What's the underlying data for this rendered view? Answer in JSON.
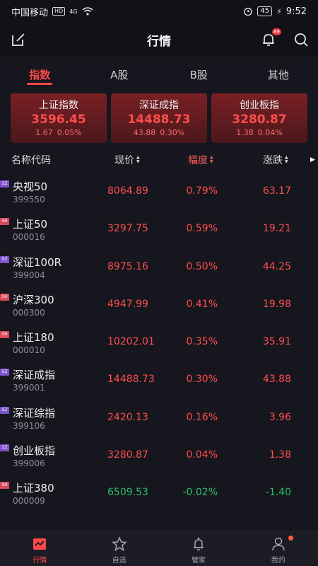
{
  "status": {
    "carrier": "中国移动",
    "hd": "HD",
    "signal": "4G",
    "battery": "45",
    "time": "9:52"
  },
  "header": {
    "title": "行情",
    "notif_count": "89"
  },
  "tabs": [
    {
      "label": "指数",
      "active": true
    },
    {
      "label": "A股",
      "active": false
    },
    {
      "label": "B股",
      "active": false
    },
    {
      "label": "其他",
      "active": false
    }
  ],
  "cards": [
    {
      "name": "上证指数",
      "value": "3596.45",
      "change": "1.67",
      "pct": "0.05%"
    },
    {
      "name": "深证成指",
      "value": "14488.73",
      "change": "43.88",
      "pct": "0.30%"
    },
    {
      "name": "创业板指",
      "value": "3280.87",
      "change": "1.38",
      "pct": "0.04%"
    }
  ],
  "table": {
    "headers": {
      "name": "名称代码",
      "price": "现价",
      "pct": "幅度",
      "change": "涨跌"
    },
    "rows": [
      {
        "market": "SZ",
        "name": "央视50",
        "code": "399550",
        "price": "8064.89",
        "pct": "0.79%",
        "change": "63.17",
        "dir": "up"
      },
      {
        "market": "SH",
        "name": "上证50",
        "code": "000016",
        "price": "3297.75",
        "pct": "0.59%",
        "change": "19.21",
        "dir": "up"
      },
      {
        "market": "SZ",
        "name": "深证100R",
        "code": "399004",
        "price": "8975.16",
        "pct": "0.50%",
        "change": "44.25",
        "dir": "up"
      },
      {
        "market": "SH",
        "name": "沪深300",
        "code": "000300",
        "price": "4947.99",
        "pct": "0.41%",
        "change": "19.98",
        "dir": "up"
      },
      {
        "market": "SH",
        "name": "上证180",
        "code": "000010",
        "price": "10202.01",
        "pct": "0.35%",
        "change": "35.91",
        "dir": "up"
      },
      {
        "market": "SZ",
        "name": "深证成指",
        "code": "399001",
        "price": "14488.73",
        "pct": "0.30%",
        "change": "43.88",
        "dir": "up"
      },
      {
        "market": "SZ",
        "name": "深证综指",
        "code": "399106",
        "price": "2420.13",
        "pct": "0.16%",
        "change": "3.96",
        "dir": "up"
      },
      {
        "market": "SZ",
        "name": "创业板指",
        "code": "399006",
        "price": "3280.87",
        "pct": "0.04%",
        "change": "1.38",
        "dir": "up"
      },
      {
        "market": "SH",
        "name": "上证380",
        "code": "000009",
        "price": "6509.53",
        "pct": "-0.02%",
        "change": "-1.40",
        "dir": "down"
      }
    ]
  },
  "bottom_nav": [
    {
      "label": "行情",
      "icon": "chart-icon",
      "active": true
    },
    {
      "label": "自选",
      "icon": "star-icon",
      "active": false
    },
    {
      "label": "管家",
      "icon": "bell-icon",
      "active": false
    },
    {
      "label": "我的",
      "icon": "user-icon",
      "active": false
    }
  ],
  "colors": {
    "up": "#ff4d4d",
    "down": "#2bbf6a",
    "accent": "#ff4848",
    "background": "#16161e"
  }
}
